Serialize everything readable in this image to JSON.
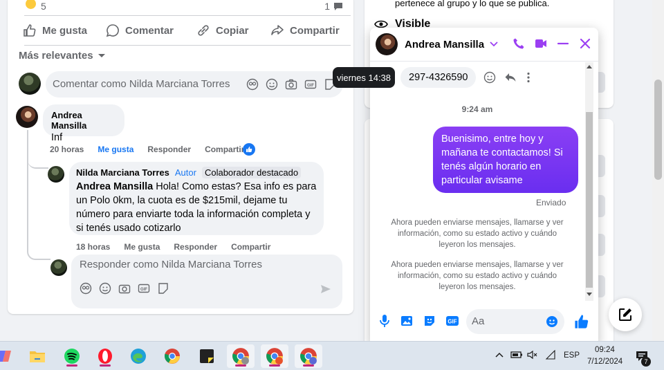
{
  "post": {
    "reaction_count": "5",
    "comment_count": "1",
    "actions": [
      {
        "label": "Me gusta",
        "icon": "thumbs-up-icon"
      },
      {
        "label": "Comentar",
        "icon": "speech-bubble-icon"
      },
      {
        "label": "Copiar",
        "icon": "link-icon"
      },
      {
        "label": "Compartir",
        "icon": "share-arrow-icon"
      }
    ],
    "sort_label": "Más relevantes",
    "comment_placeholder": "Comentar como Nilda Marciana Torres",
    "comments": [
      {
        "author": "Andrea Mansilla",
        "text": "Inf",
        "time": "20 horas",
        "like": "Me gusta",
        "reply": "Responder",
        "share": "Compartir"
      }
    ],
    "reply": {
      "author": "Nilda Marciana Torres",
      "badge_author": "Autor",
      "badge_collab": "Colaborador destacado",
      "mention": "Andrea Mansilla",
      "text": " Hola! Como estas? Esa info es para un Polo 0km, la cuota es de $215mil, dejame tu número para enviarte toda la información completa y si tenés usado cotizarlo",
      "time": "18 horas",
      "like": "Me gusta",
      "reply": "Responder",
      "share": "Compartir"
    },
    "reply_placeholder": "Responder como Nilda Marciana Torres"
  },
  "right_panel": {
    "top_text": "pertenece al grupo y lo que se publica.",
    "visible_label": "Visible"
  },
  "chat": {
    "contact_name": "Andrea Mansilla",
    "phone_message": "297-4326590",
    "tooltip": "viernes 14:38",
    "time_divider": "9:24 am",
    "outgoing_message": "Buenisimo, entre hoy y mañana te contactamos! Si tenés algún horario en particular avisame",
    "status": "Enviado",
    "system_messages": [
      "Ahora pueden enviarse mensajes, llamarse y ver información, como su estado activo y cuándo leyeron los mensajes.",
      "Ahora pueden enviarse mensajes, llamarse y ver información, como su estado activo y cuándo leyeron los mensajes."
    ],
    "input_placeholder": "Aa",
    "colors": {
      "accent": "#7b3ff2",
      "messenger_blue": "#0a7cff"
    }
  },
  "taskbar": {
    "apps": [
      "copilot",
      "file-explorer",
      "spotify",
      "opera",
      "edge",
      "chrome",
      "sticky-notes",
      "chrome-profile-1",
      "chrome-profile-2",
      "chrome-profile-3"
    ],
    "language": "ESP",
    "time": "09:24",
    "date": "7/12/2024",
    "notification_count": "7"
  }
}
